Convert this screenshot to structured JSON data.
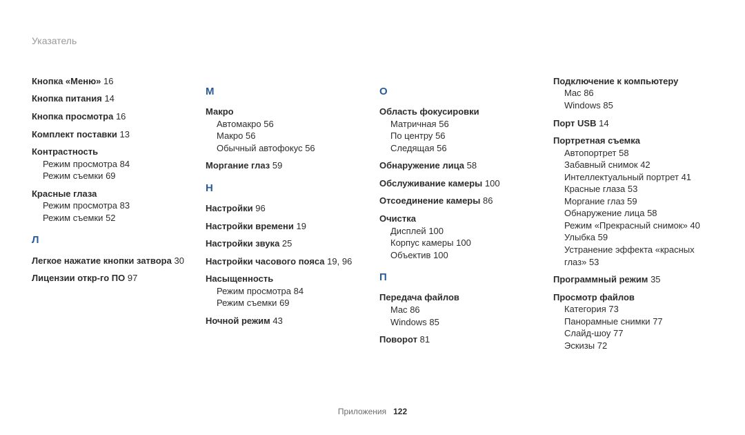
{
  "header": "Указатель",
  "footer": {
    "section": "Приложения",
    "page": "122"
  },
  "columns": [
    {
      "items": [
        {
          "type": "entry",
          "title": "Кнопка «Меню»",
          "page": "16"
        },
        {
          "type": "entry",
          "title": "Кнопка питания",
          "page": "14"
        },
        {
          "type": "entry",
          "title": "Кнопка просмотра",
          "page": "16"
        },
        {
          "type": "entry",
          "title": "Комплект поставки",
          "page": "13"
        },
        {
          "type": "entry",
          "title": "Контрастность",
          "subs": [
            {
              "text": "Режим просмотра",
              "page": "84"
            },
            {
              "text": "Режим съемки",
              "page": "69"
            }
          ]
        },
        {
          "type": "entry",
          "title": "Красные глаза",
          "subs": [
            {
              "text": "Режим просмотра",
              "page": "83"
            },
            {
              "text": "Режим съемки",
              "page": "52"
            }
          ]
        },
        {
          "type": "letter",
          "text": "Л"
        },
        {
          "type": "entry",
          "title": "Легкое нажатие кнопки затвора",
          "page": "30"
        },
        {
          "type": "entry",
          "title": "Лицензии откр-го ПО",
          "page": "97"
        }
      ]
    },
    {
      "items": [
        {
          "type": "letter",
          "text": "М"
        },
        {
          "type": "entry",
          "title": "Макро",
          "subs": [
            {
              "text": "Автомакро",
              "page": "56"
            },
            {
              "text": "Макро",
              "page": "56"
            },
            {
              "text": "Обычный автофокус",
              "page": "56"
            }
          ]
        },
        {
          "type": "entry",
          "title": "Моргание глаз",
          "page": "59"
        },
        {
          "type": "letter",
          "text": "Н"
        },
        {
          "type": "entry",
          "title": "Настройки",
          "page": "96"
        },
        {
          "type": "entry",
          "title": "Настройки времени",
          "page": "19"
        },
        {
          "type": "entry",
          "title": "Настройки звука",
          "page": "25"
        },
        {
          "type": "entry",
          "title": "Настройки часового пояса",
          "page": "19, 96"
        },
        {
          "type": "entry",
          "title": "Насыщенность",
          "subs": [
            {
              "text": "Режим просмотра",
              "page": "84"
            },
            {
              "text": "Режим съемки",
              "page": "69"
            }
          ]
        },
        {
          "type": "entry",
          "title": "Ночной режим",
          "page": "43"
        }
      ]
    },
    {
      "items": [
        {
          "type": "letter",
          "text": "О"
        },
        {
          "type": "entry",
          "title": "Область фокусировки",
          "subs": [
            {
              "text": "Матричная",
              "page": "56"
            },
            {
              "text": "По центру",
              "page": "56"
            },
            {
              "text": "Следящая",
              "page": "56"
            }
          ]
        },
        {
          "type": "entry",
          "title": "Обнаружение лица",
          "page": "58"
        },
        {
          "type": "entry",
          "title": "Обслуживание камеры",
          "page": "100"
        },
        {
          "type": "entry",
          "title": "Отсоединение камеры",
          "page": "86"
        },
        {
          "type": "entry",
          "title": "Очистка",
          "subs": [
            {
              "text": "Дисплей",
              "page": "100"
            },
            {
              "text": "Корпус камеры",
              "page": "100"
            },
            {
              "text": "Объектив",
              "page": "100"
            }
          ]
        },
        {
          "type": "letter",
          "text": "П"
        },
        {
          "type": "entry",
          "title": "Передача файлов",
          "subs": [
            {
              "text": "Mac",
              "page": "86"
            },
            {
              "text": "Windows",
              "page": "85"
            }
          ]
        },
        {
          "type": "entry",
          "title": "Поворот",
          "page": "81"
        }
      ]
    },
    {
      "items": [
        {
          "type": "entry",
          "title": "Подключение к компьютеру",
          "subs": [
            {
              "text": "Mac",
              "page": "86"
            },
            {
              "text": "Windows",
              "page": "85"
            }
          ]
        },
        {
          "type": "entry",
          "title": "Порт USB",
          "page": "14"
        },
        {
          "type": "entry",
          "title": "Портретная съемка",
          "subs": [
            {
              "text": "Автопортрет",
              "page": "58"
            },
            {
              "text": "Забавный снимок",
              "page": "42"
            },
            {
              "text": "Интеллектуальный портрет",
              "page": "41"
            },
            {
              "text": "Красные глаза",
              "page": "53"
            },
            {
              "text": "Моргание глаз",
              "page": "59"
            },
            {
              "text": "Обнаружение лица",
              "page": "58"
            },
            {
              "text": "Режим «Прекрасный снимок»",
              "page": "40"
            },
            {
              "text": "Улыбка",
              "page": "59"
            },
            {
              "text": "Устранение эффекта «красных глаз»",
              "page": "53"
            }
          ]
        },
        {
          "type": "entry",
          "title": "Программный режим",
          "page": "35"
        },
        {
          "type": "entry",
          "title": "Просмотр файлов",
          "subs": [
            {
              "text": "Категория",
              "page": "73"
            },
            {
              "text": "Панорамные снимки",
              "page": "77"
            },
            {
              "text": "Слайд-шоу",
              "page": "77"
            },
            {
              "text": "Эскизы",
              "page": "72"
            }
          ]
        }
      ]
    }
  ]
}
